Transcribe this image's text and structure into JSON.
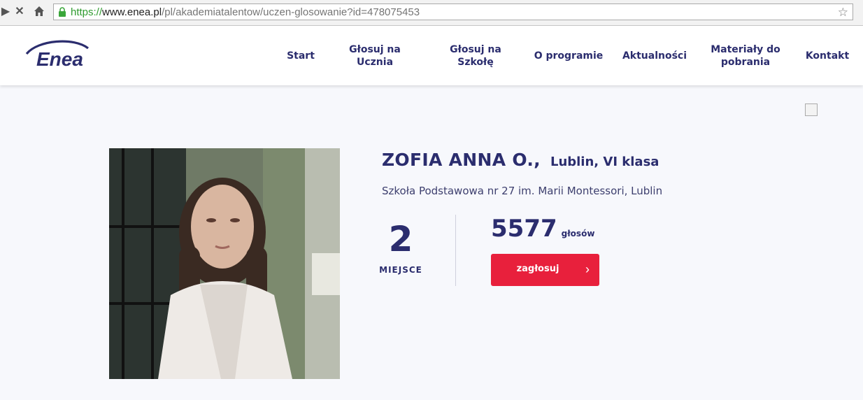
{
  "browser": {
    "url_proto": "https://",
    "url_host": "www.enea.pl",
    "url_path": "/pl/akademiatalentow/uczen-glosowanie?id=478075453",
    "back_icon": "back-icon",
    "stop_icon": "stop-icon",
    "home_icon": "home-icon",
    "bookmark_icon": "star-icon"
  },
  "header": {
    "logo_text": "Enea",
    "nav": [
      {
        "label": "Start"
      },
      {
        "label": "Głosuj na Ucznia"
      },
      {
        "label": "Głosuj na Szkołę"
      },
      {
        "label": "O programie"
      },
      {
        "label": "Aktualności"
      },
      {
        "label": "Materiały do pobrania"
      },
      {
        "label": "Kontakt"
      }
    ]
  },
  "student": {
    "name": "ZOFIA ANNA O.,",
    "city_class": "Lublin, VI klasa",
    "school": "Szkoła Podstawowa nr 27 im. Marii Montessori, Lublin",
    "place": "2",
    "place_label": "MIEJSCE",
    "votes": "5577",
    "votes_label": "głosów",
    "vote_button": "zagłosuj"
  },
  "colors": {
    "brand_navy": "#2b2d6e",
    "vote_red": "#e8203c",
    "page_bg": "#f7f8fc"
  }
}
